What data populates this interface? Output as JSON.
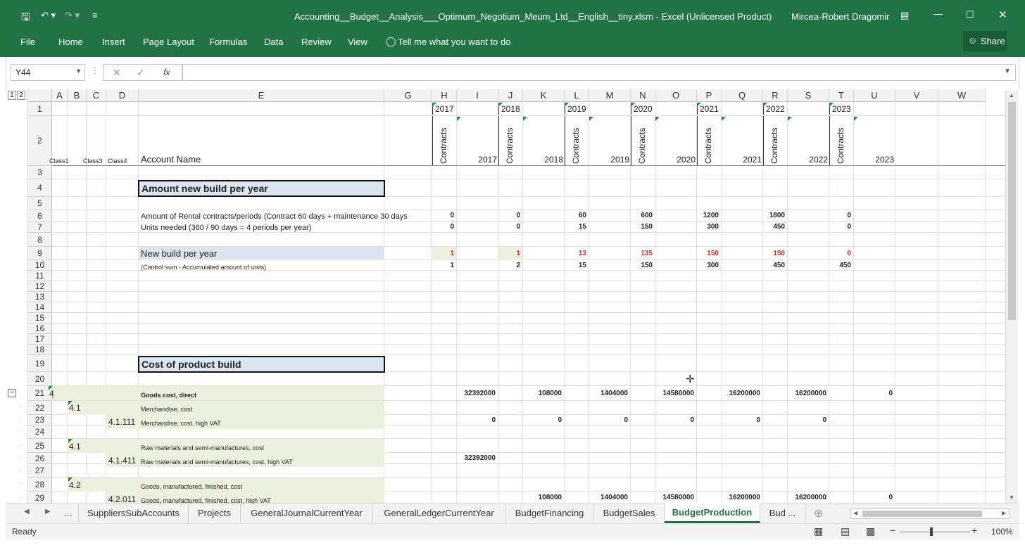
{
  "app": {
    "title": "Accounting__Budget__Analysis___Optimum_Negotium_Meum_Ltd__English__tiny.xlsm  -  Excel (Unlicensed Product)",
    "user": "Mircea-Robert Dragomir",
    "share": "Share"
  },
  "menu": [
    "File",
    "Home",
    "Insert",
    "Page Layout",
    "Formulas",
    "Data",
    "Review",
    "View"
  ],
  "tell": "Tell me what you want to do",
  "namebox": "Y44",
  "fx": "fx",
  "outline": [
    "1",
    "2"
  ],
  "columns": [
    "A",
    "B",
    "C",
    "D",
    "E",
    "G",
    "H",
    "I",
    "J",
    "K",
    "L",
    "M",
    "N",
    "O",
    "P",
    "Q",
    "R",
    "S",
    "T",
    "U",
    "V",
    "W"
  ],
  "rows": [
    "1",
    "2",
    "3",
    "4",
    "5",
    "6",
    "7",
    "8",
    "9",
    "10",
    "11",
    "12",
    "13",
    "14",
    "15",
    "16",
    "17",
    "18",
    "19",
    "20",
    "21",
    "22",
    "23",
    "24",
    "25",
    "26",
    "27",
    "28",
    "29"
  ],
  "years": [
    "2017",
    "2018",
    "2019",
    "2020",
    "2021",
    "2022",
    "2023"
  ],
  "contracts": "Contracts",
  "header2": {
    "a": "Class1",
    "c": "Class3",
    "d": "Class4",
    "e": "Account Name"
  },
  "section1": "Amount new build per year",
  "section2": "Cost of product build",
  "cells": {
    "r6e": "Amount of Rental contracts/periods (Contract 60 days + maintenance 30 days",
    "r7e": "Units needed (360 / 90 days = 4 periods per year)",
    "r9e": "New build per year",
    "r10e": "(Control sum - Accumulated amount of units)",
    "r21a": "4",
    "r21e": "Goods cost, direct",
    "r22b": "4.1",
    "r22e": "Merchandise, cost",
    "r23d": "4.1.111",
    "r23e": "Merchandise, cost, high VAT",
    "r25b": "4.1",
    "r25e": "Raw materials and semi-manufactures, cost",
    "r26d": "4.1.411",
    "r26e": "Raw materials and semi-manufactures, cost, high VAT",
    "r28b": "4.2",
    "r28e": "Goods, manufactured, finished, cost",
    "r29d": "4.2.011",
    "r29e": "Goods, manufactured, finished, cost, high VAT"
  },
  "vals": {
    "r6": [
      "0",
      "0",
      "60",
      "600",
      "1200",
      "1800",
      "0"
    ],
    "r7": [
      "0",
      "0",
      "15",
      "150",
      "300",
      "450",
      "0"
    ],
    "r9": [
      "1",
      "1",
      "13",
      "135",
      "150",
      "150",
      "0"
    ],
    "r10": [
      "1",
      "2",
      "15",
      "150",
      "300",
      "450",
      "450"
    ],
    "r21": [
      "32392000",
      "108000",
      "1404000",
      "14580000",
      "16200000",
      "16200000",
      "0"
    ],
    "r23": [
      "0",
      "0",
      "0",
      "0",
      "0",
      "0"
    ],
    "r26": [
      "32392000"
    ],
    "r29": [
      "108000",
      "1404000",
      "14580000",
      "16200000",
      "16200000",
      "0"
    ]
  },
  "tabs": [
    "...",
    "SuppliersSubAccounts",
    "Projects",
    "GeneralJournalCurrentYear",
    "GeneralLedgerCurrentYear",
    "BudgetFinancing",
    "BudgetSales",
    "BudgetProduction",
    "Bud ...",
    "..."
  ],
  "status": {
    "ready": "Ready",
    "zoom": "100%"
  }
}
